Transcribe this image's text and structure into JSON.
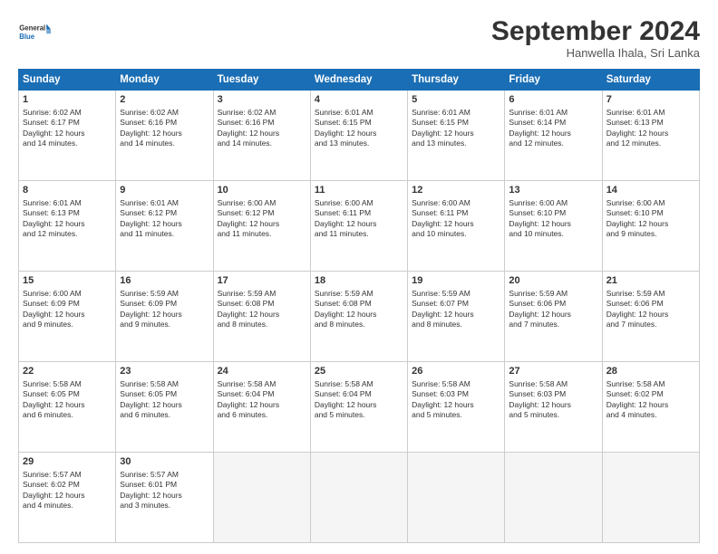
{
  "logo": {
    "line1": "General",
    "line2": "Blue"
  },
  "title": "September 2024",
  "subtitle": "Hanwella Ihala, Sri Lanka",
  "days_of_week": [
    "Sunday",
    "Monday",
    "Tuesday",
    "Wednesday",
    "Thursday",
    "Friday",
    "Saturday"
  ],
  "weeks": [
    [
      {
        "day": 1,
        "lines": [
          "Sunrise: 6:02 AM",
          "Sunset: 6:17 PM",
          "Daylight: 12 hours",
          "and 14 minutes."
        ]
      },
      {
        "day": 2,
        "lines": [
          "Sunrise: 6:02 AM",
          "Sunset: 6:16 PM",
          "Daylight: 12 hours",
          "and 14 minutes."
        ]
      },
      {
        "day": 3,
        "lines": [
          "Sunrise: 6:02 AM",
          "Sunset: 6:16 PM",
          "Daylight: 12 hours",
          "and 14 minutes."
        ]
      },
      {
        "day": 4,
        "lines": [
          "Sunrise: 6:01 AM",
          "Sunset: 6:15 PM",
          "Daylight: 12 hours",
          "and 13 minutes."
        ]
      },
      {
        "day": 5,
        "lines": [
          "Sunrise: 6:01 AM",
          "Sunset: 6:15 PM",
          "Daylight: 12 hours",
          "and 13 minutes."
        ]
      },
      {
        "day": 6,
        "lines": [
          "Sunrise: 6:01 AM",
          "Sunset: 6:14 PM",
          "Daylight: 12 hours",
          "and 12 minutes."
        ]
      },
      {
        "day": 7,
        "lines": [
          "Sunrise: 6:01 AM",
          "Sunset: 6:13 PM",
          "Daylight: 12 hours",
          "and 12 minutes."
        ]
      }
    ],
    [
      {
        "day": 8,
        "lines": [
          "Sunrise: 6:01 AM",
          "Sunset: 6:13 PM",
          "Daylight: 12 hours",
          "and 12 minutes."
        ]
      },
      {
        "day": 9,
        "lines": [
          "Sunrise: 6:01 AM",
          "Sunset: 6:12 PM",
          "Daylight: 12 hours",
          "and 11 minutes."
        ]
      },
      {
        "day": 10,
        "lines": [
          "Sunrise: 6:00 AM",
          "Sunset: 6:12 PM",
          "Daylight: 12 hours",
          "and 11 minutes."
        ]
      },
      {
        "day": 11,
        "lines": [
          "Sunrise: 6:00 AM",
          "Sunset: 6:11 PM",
          "Daylight: 12 hours",
          "and 11 minutes."
        ]
      },
      {
        "day": 12,
        "lines": [
          "Sunrise: 6:00 AM",
          "Sunset: 6:11 PM",
          "Daylight: 12 hours",
          "and 10 minutes."
        ]
      },
      {
        "day": 13,
        "lines": [
          "Sunrise: 6:00 AM",
          "Sunset: 6:10 PM",
          "Daylight: 12 hours",
          "and 10 minutes."
        ]
      },
      {
        "day": 14,
        "lines": [
          "Sunrise: 6:00 AM",
          "Sunset: 6:10 PM",
          "Daylight: 12 hours",
          "and 9 minutes."
        ]
      }
    ],
    [
      {
        "day": 15,
        "lines": [
          "Sunrise: 6:00 AM",
          "Sunset: 6:09 PM",
          "Daylight: 12 hours",
          "and 9 minutes."
        ]
      },
      {
        "day": 16,
        "lines": [
          "Sunrise: 5:59 AM",
          "Sunset: 6:09 PM",
          "Daylight: 12 hours",
          "and 9 minutes."
        ]
      },
      {
        "day": 17,
        "lines": [
          "Sunrise: 5:59 AM",
          "Sunset: 6:08 PM",
          "Daylight: 12 hours",
          "and 8 minutes."
        ]
      },
      {
        "day": 18,
        "lines": [
          "Sunrise: 5:59 AM",
          "Sunset: 6:08 PM",
          "Daylight: 12 hours",
          "and 8 minutes."
        ]
      },
      {
        "day": 19,
        "lines": [
          "Sunrise: 5:59 AM",
          "Sunset: 6:07 PM",
          "Daylight: 12 hours",
          "and 8 minutes."
        ]
      },
      {
        "day": 20,
        "lines": [
          "Sunrise: 5:59 AM",
          "Sunset: 6:06 PM",
          "Daylight: 12 hours",
          "and 7 minutes."
        ]
      },
      {
        "day": 21,
        "lines": [
          "Sunrise: 5:59 AM",
          "Sunset: 6:06 PM",
          "Daylight: 12 hours",
          "and 7 minutes."
        ]
      }
    ],
    [
      {
        "day": 22,
        "lines": [
          "Sunrise: 5:58 AM",
          "Sunset: 6:05 PM",
          "Daylight: 12 hours",
          "and 6 minutes."
        ]
      },
      {
        "day": 23,
        "lines": [
          "Sunrise: 5:58 AM",
          "Sunset: 6:05 PM",
          "Daylight: 12 hours",
          "and 6 minutes."
        ]
      },
      {
        "day": 24,
        "lines": [
          "Sunrise: 5:58 AM",
          "Sunset: 6:04 PM",
          "Daylight: 12 hours",
          "and 6 minutes."
        ]
      },
      {
        "day": 25,
        "lines": [
          "Sunrise: 5:58 AM",
          "Sunset: 6:04 PM",
          "Daylight: 12 hours",
          "and 5 minutes."
        ]
      },
      {
        "day": 26,
        "lines": [
          "Sunrise: 5:58 AM",
          "Sunset: 6:03 PM",
          "Daylight: 12 hours",
          "and 5 minutes."
        ]
      },
      {
        "day": 27,
        "lines": [
          "Sunrise: 5:58 AM",
          "Sunset: 6:03 PM",
          "Daylight: 12 hours",
          "and 5 minutes."
        ]
      },
      {
        "day": 28,
        "lines": [
          "Sunrise: 5:58 AM",
          "Sunset: 6:02 PM",
          "Daylight: 12 hours",
          "and 4 minutes."
        ]
      }
    ],
    [
      {
        "day": 29,
        "lines": [
          "Sunrise: 5:57 AM",
          "Sunset: 6:02 PM",
          "Daylight: 12 hours",
          "and 4 minutes."
        ]
      },
      {
        "day": 30,
        "lines": [
          "Sunrise: 5:57 AM",
          "Sunset: 6:01 PM",
          "Daylight: 12 hours",
          "and 3 minutes."
        ]
      },
      {
        "day": null,
        "lines": []
      },
      {
        "day": null,
        "lines": []
      },
      {
        "day": null,
        "lines": []
      },
      {
        "day": null,
        "lines": []
      },
      {
        "day": null,
        "lines": []
      }
    ]
  ]
}
